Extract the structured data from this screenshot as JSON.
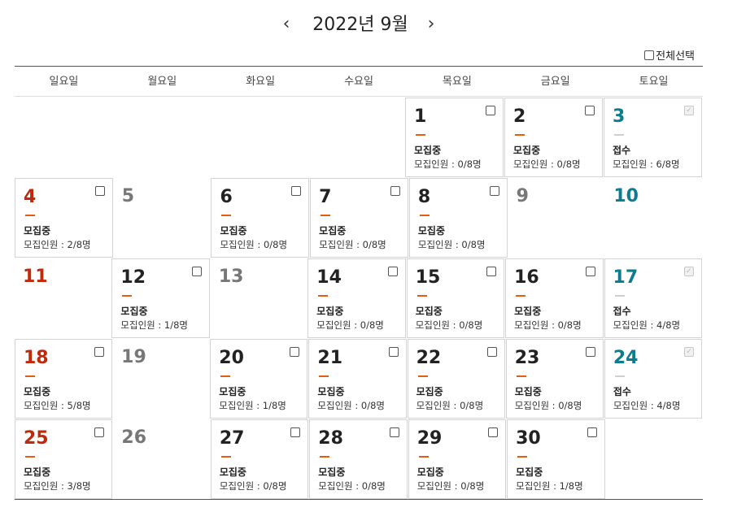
{
  "header": {
    "prev_icon": "‹",
    "title": "2022년 9월",
    "next_icon": "›"
  },
  "select_all": {
    "label": "전체선택"
  },
  "weekdays": [
    "일요일",
    "월요일",
    "화요일",
    "수요일",
    "목요일",
    "금요일",
    "토요일"
  ],
  "colors": {
    "sunday": "#c02a0b",
    "saturday": "#0d7b90",
    "dash": "#e35d15",
    "closed_day": "#777777"
  },
  "weeks": [
    [
      {
        "empty": true
      },
      {
        "empty": true
      },
      {
        "empty": true
      },
      {
        "empty": true
      },
      {
        "day": "1",
        "type": "weekday",
        "status": "모집중",
        "count": "모집인원 : 0/8명",
        "checkbox": "on"
      },
      {
        "day": "2",
        "type": "weekday",
        "status": "모집중",
        "count": "모집인원 : 0/8명",
        "checkbox": "on"
      },
      {
        "day": "3",
        "type": "saturday",
        "status": "접수",
        "count": "모집인원 : 6/8명",
        "checkbox": "disabled"
      }
    ],
    [
      {
        "day": "4",
        "type": "sunday",
        "status": "모집중",
        "count": "모집인원 : 2/8명",
        "checkbox": "on"
      },
      {
        "day": "5",
        "type": "noclass"
      },
      {
        "day": "6",
        "type": "weekday",
        "status": "모집중",
        "count": "모집인원 : 0/8명",
        "checkbox": "on"
      },
      {
        "day": "7",
        "type": "weekday",
        "status": "모집중",
        "count": "모집인원 : 0/8명",
        "checkbox": "on"
      },
      {
        "day": "8",
        "type": "weekday",
        "status": "모집중",
        "count": "모집인원 : 0/8명",
        "checkbox": "on"
      },
      {
        "day": "9",
        "type": "noclass"
      },
      {
        "day": "10",
        "type": "saturday-plain"
      }
    ],
    [
      {
        "day": "11",
        "type": "sunday-plain"
      },
      {
        "day": "12",
        "type": "weekday",
        "status": "모집중",
        "count": "모집인원 : 1/8명",
        "checkbox": "on"
      },
      {
        "day": "13",
        "type": "noclass"
      },
      {
        "day": "14",
        "type": "weekday",
        "status": "모집중",
        "count": "모집인원 : 0/8명",
        "checkbox": "on"
      },
      {
        "day": "15",
        "type": "weekday",
        "status": "모집중",
        "count": "모집인원 : 0/8명",
        "checkbox": "on"
      },
      {
        "day": "16",
        "type": "weekday",
        "status": "모집중",
        "count": "모집인원 : 0/8명",
        "checkbox": "on"
      },
      {
        "day": "17",
        "type": "saturday",
        "status": "접수",
        "count": "모집인원 : 4/8명",
        "checkbox": "disabled"
      }
    ],
    [
      {
        "day": "18",
        "type": "sunday",
        "status": "모집중",
        "count": "모집인원 : 5/8명",
        "checkbox": "on"
      },
      {
        "day": "19",
        "type": "noclass"
      },
      {
        "day": "20",
        "type": "weekday",
        "status": "모집중",
        "count": "모집인원 : 1/8명",
        "checkbox": "on"
      },
      {
        "day": "21",
        "type": "weekday",
        "status": "모집중",
        "count": "모집인원 : 0/8명",
        "checkbox": "on"
      },
      {
        "day": "22",
        "type": "weekday",
        "status": "모집중",
        "count": "모집인원 : 0/8명",
        "checkbox": "on"
      },
      {
        "day": "23",
        "type": "weekday",
        "status": "모집중",
        "count": "모집인원 : 0/8명",
        "checkbox": "on"
      },
      {
        "day": "24",
        "type": "saturday",
        "status": "접수",
        "count": "모집인원 : 4/8명",
        "checkbox": "disabled"
      }
    ],
    [
      {
        "day": "25",
        "type": "sunday",
        "status": "모집중",
        "count": "모집인원 : 3/8명",
        "checkbox": "on"
      },
      {
        "day": "26",
        "type": "noclass"
      },
      {
        "day": "27",
        "type": "weekday",
        "status": "모집중",
        "count": "모집인원 : 0/8명",
        "checkbox": "on"
      },
      {
        "day": "28",
        "type": "weekday",
        "status": "모집중",
        "count": "모집인원 : 0/8명",
        "checkbox": "on"
      },
      {
        "day": "29",
        "type": "weekday",
        "status": "모집중",
        "count": "모집인원 : 0/8명",
        "checkbox": "on"
      },
      {
        "day": "30",
        "type": "weekday",
        "status": "모집중",
        "count": "모집인원 : 1/8명",
        "checkbox": "on"
      },
      {
        "empty": true
      }
    ]
  ]
}
